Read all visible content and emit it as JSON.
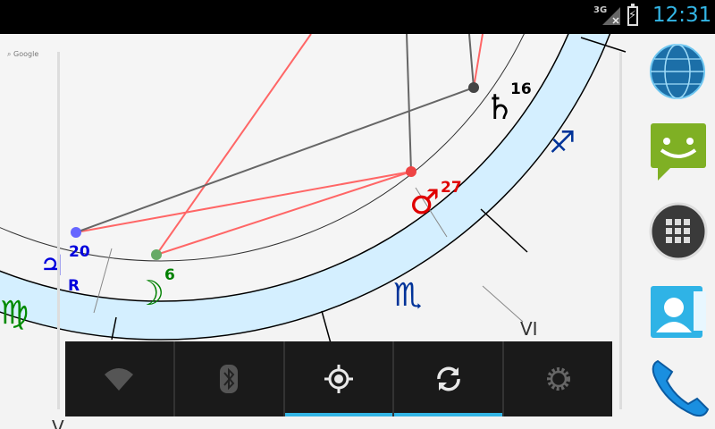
{
  "status_bar": {
    "network_type": "3G",
    "time": "12:31",
    "icons": [
      "signal-icon",
      "battery-charging-icon"
    ]
  },
  "map_credit": "Google",
  "chart": {
    "house_labels": [
      "VI",
      "V"
    ],
    "planets": [
      {
        "name": "saturn-glyph",
        "symbol": "♄",
        "degree": "16",
        "color": "#000000"
      },
      {
        "name": "mars-glyph",
        "symbol": "♂",
        "degree": "27",
        "color": "#ff0000"
      },
      {
        "name": "jupiter-glyph",
        "symbol": "♃",
        "degree": "20",
        "retro": "R",
        "color": "#0000ff"
      },
      {
        "name": "moon-glyph",
        "symbol": "☽",
        "degree": "6",
        "color": "#008000"
      }
    ],
    "signs": [
      {
        "name": "sagittarius-icon",
        "symbol": "♐",
        "color": "#003399"
      },
      {
        "name": "scorpio-icon",
        "symbol": "♏",
        "color": "#003399"
      },
      {
        "name": "virgo-icon",
        "symbol": "♍",
        "color": "#008a00"
      }
    ],
    "colors": {
      "ring_fill": "#d4efff",
      "aspect_red": "#ff6666",
      "aspect_gray": "#666666"
    }
  },
  "quick_settings": [
    {
      "name": "wifi-toggle",
      "icon": "wifi-icon",
      "active": false
    },
    {
      "name": "bluetooth-toggle",
      "icon": "bluetooth-icon",
      "active": false
    },
    {
      "name": "gps-toggle",
      "icon": "gps-icon",
      "active": true
    },
    {
      "name": "sync-toggle",
      "icon": "sync-icon",
      "active": true
    },
    {
      "name": "brightness-toggle",
      "icon": "brightness-icon",
      "active": false
    }
  ],
  "dock": [
    {
      "name": "browser-icon"
    },
    {
      "name": "messaging-icon"
    },
    {
      "name": "app-drawer-icon"
    },
    {
      "name": "contacts-icon"
    },
    {
      "name": "phone-icon"
    }
  ]
}
